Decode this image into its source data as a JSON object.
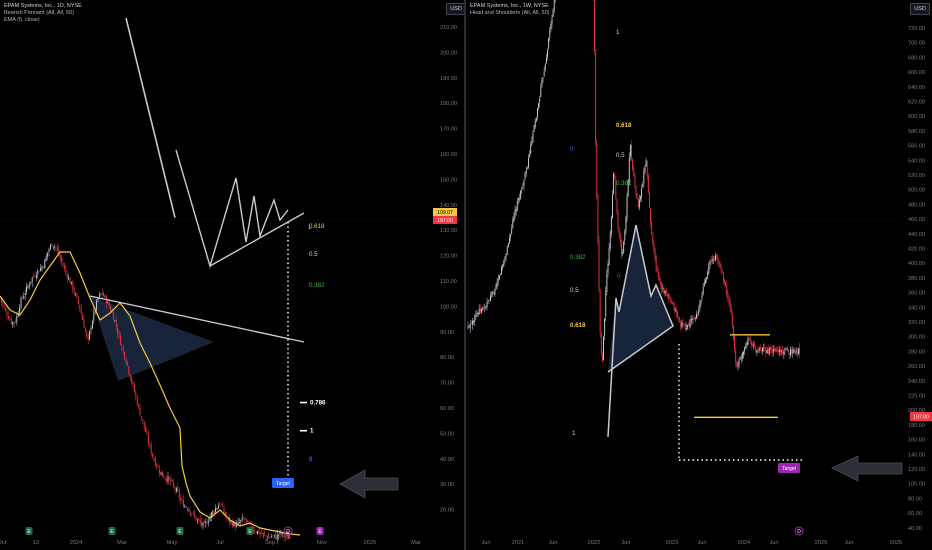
{
  "left_chart": {
    "header": {
      "title": "EPAM Systems, Inc., 1D, NYSE",
      "indicator1": "Bearish Pennant (All, All, 50)",
      "indicator2": "EMA (5, close)"
    },
    "currency_button": "USD",
    "price_tags": [
      "199.07",
      "197.00"
    ],
    "target_label": "Target",
    "pennant_label": "1",
    "fib_labels": [
      {
        "text": "0.618",
        "value": 133,
        "color": "#f5c842"
      },
      {
        "text": "0.5",
        "value": 122,
        "color": "#d1d4dc"
      },
      {
        "text": "0.382",
        "value": 110,
        "color": "#4caf50"
      },
      {
        "text": "0.786",
        "value": 64,
        "color": "#ffffff"
      },
      {
        "text": "1",
        "value": 53,
        "color": "#ffffff"
      },
      {
        "text": "0",
        "value": 42,
        "color": "#2962ff"
      }
    ],
    "event_icons": [
      "E",
      "E",
      "E",
      "E",
      "D",
      "E"
    ],
    "colors": {
      "up": "#d1d4dc",
      "down": "#f23645",
      "ema": "#f5c842",
      "pattern": "#c7cad1",
      "fill": "#1c2a44",
      "target": "#2962ff"
    }
  },
  "right_chart": {
    "header": {
      "title": "EPAM Systems, Inc., 1W, NYSE",
      "indicator1": "Head and Shoulders (All, All, 50)"
    },
    "currency_button": "USD",
    "price_tag": "197.00",
    "target_label": "Target",
    "fib_labels": [
      {
        "text": "1",
        "value": 715,
        "color": "#d1d4dc"
      },
      {
        "text": "0.618",
        "value": 542,
        "color": "#f5c842"
      },
      {
        "text": "0.5",
        "value": 512,
        "color": "#d1d4dc"
      },
      {
        "text": "0.382",
        "value": 482,
        "color": "#4caf50"
      },
      {
        "text": "0",
        "value": 500,
        "color": "#2962ff"
      },
      {
        "text": "0.382",
        "value": 409,
        "color": "#4caf50"
      },
      {
        "text": "0",
        "value": 377,
        "color": "#2962ff"
      },
      {
        "text": "0.5",
        "value": 352,
        "color": "#d1d4dc"
      },
      {
        "text": "0.618",
        "value": 325,
        "color": "#f5c842"
      },
      {
        "text": "1",
        "value": 166,
        "color": "#d1d4dc"
      }
    ],
    "event_icon": "D",
    "colors": {
      "up": "#d1d4dc",
      "down": "#f23645",
      "pattern": "#c7cad1",
      "fill": "#1c2a44",
      "neckline": "#f5c842",
      "target": "#9c27b0"
    }
  },
  "chart_data": [
    {
      "type": "candlestick",
      "title": "EPAM Systems, Inc., 1D, NYSE",
      "x_tick_labels": [
        "Oct",
        "13",
        "2024",
        "Mar",
        "May",
        "Jul",
        "Sep",
        "Nov",
        "2025",
        "Mar"
      ],
      "y_tick_labels": [
        "210.00",
        "200.00",
        "190.00",
        "180.00",
        "170.00",
        "160.00",
        "150.00",
        "140.00",
        "130.00",
        "120.00",
        "110.00",
        "100.00",
        "90.00",
        "80.00",
        "70.00",
        "60.00",
        "50.00",
        "40.00",
        "30.00",
        "20.00"
      ],
      "ylim": [
        15,
        215
      ],
      "price_path": [
        [
          0,
          250
        ],
        [
          4,
          240
        ],
        [
          8,
          232
        ],
        [
          12,
          225
        ],
        [
          16,
          228
        ],
        [
          20,
          245
        ],
        [
          24,
          254
        ],
        [
          28,
          262
        ],
        [
          32,
          270
        ],
        [
          36,
          275
        ],
        [
          40,
          279
        ],
        [
          44,
          284
        ],
        [
          48,
          297
        ],
        [
          52,
          305
        ],
        [
          56,
          300
        ],
        [
          60,
          290
        ],
        [
          66,
          275
        ],
        [
          72,
          262
        ],
        [
          80,
          240
        ],
        [
          88,
          205
        ],
        [
          90,
          218
        ],
        [
          94,
          235
        ],
        [
          98,
          250
        ],
        [
          102,
          255
        ],
        [
          106,
          248
        ],
        [
          110,
          240
        ],
        [
          114,
          230
        ],
        [
          118,
          215
        ],
        [
          122,
          200
        ],
        [
          126,
          188
        ],
        [
          130,
          172
        ],
        [
          134,
          158
        ],
        [
          138,
          142
        ],
        [
          142,
          128
        ],
        [
          146,
          115
        ],
        [
          150,
          100
        ],
        [
          154,
          88
        ],
        [
          158,
          80
        ],
        [
          162,
          73
        ],
        [
          166,
          70
        ],
        [
          170,
          68
        ],
        [
          174,
          60
        ],
        [
          178,
          55
        ],
        [
          181,
          46
        ],
        [
          184,
          43
        ],
        [
          188,
          40
        ],
        [
          192,
          35
        ],
        [
          196,
          29
        ],
        [
          200,
          25
        ],
        [
          204,
          22
        ],
        [
          208,
          28
        ],
        [
          212,
          35
        ],
        [
          216,
          40
        ],
        [
          220,
          45
        ],
        [
          224,
          35
        ],
        [
          228,
          28
        ],
        [
          232,
          25
        ],
        [
          236,
          22
        ],
        [
          240,
          26
        ],
        [
          244,
          29
        ],
        [
          248,
          24
        ],
        [
          252,
          20
        ],
        [
          256,
          17
        ],
        [
          260,
          15
        ],
        [
          264,
          13
        ],
        [
          268,
          10
        ],
        [
          272,
          12
        ],
        [
          276,
          11
        ],
        [
          280,
          15
        ],
        [
          284,
          12
        ],
        [
          288,
          10
        ],
        [
          292,
          13
        ],
        [
          296,
          14
        ],
        [
          300,
          14
        ],
        [
          304,
          13
        ]
      ],
      "ema_path": [
        [
          0,
          252
        ],
        [
          10,
          238
        ],
        [
          20,
          233
        ],
        [
          30,
          248
        ],
        [
          40,
          268
        ],
        [
          50,
          282
        ],
        [
          60,
          296
        ],
        [
          70,
          296
        ],
        [
          80,
          275
        ],
        [
          90,
          250
        ],
        [
          100,
          228
        ],
        [
          110,
          235
        ],
        [
          120,
          245
        ],
        [
          130,
          232
        ],
        [
          140,
          205
        ],
        [
          150,
          185
        ],
        [
          160,
          163
        ],
        [
          170,
          140
        ],
        [
          180,
          120
        ],
        [
          182,
          82
        ],
        [
          186,
          65
        ],
        [
          190,
          52
        ],
        [
          200,
          36
        ],
        [
          210,
          30
        ],
        [
          220,
          38
        ],
        [
          230,
          28
        ],
        [
          240,
          22
        ],
        [
          250,
          25
        ],
        [
          260,
          20
        ],
        [
          270,
          18
        ],
        [
          280,
          16
        ],
        [
          290,
          14
        ],
        [
          300,
          13
        ]
      ],
      "pennant": {
        "apex": [
          214,
          206
        ],
        "upper": [
          [
            90,
            252
          ],
          [
            214,
            206
          ]
        ],
        "lower": [
          [
            118,
            167
          ],
          [
            214,
            206
          ]
        ],
        "zigzag": [
          [
            175,
            246
          ],
          [
            183,
            168
          ],
          [
            187,
            234
          ],
          [
            190,
            173
          ],
          [
            198,
            225
          ],
          [
            201,
            175
          ],
          [
            206,
            221
          ],
          [
            209,
            192
          ],
          [
            212,
            210
          ]
        ]
      },
      "target_value": 42,
      "last_price": 197.0
    },
    {
      "type": "candlestick",
      "title": "EPAM Systems, Inc., 1W, NYSE",
      "x_tick_labels": [
        "Jun",
        "2021",
        "Jun",
        "2022",
        "Jun",
        "2023",
        "Jun",
        "2024",
        "Jun",
        "2025",
        "Jun",
        "2026"
      ],
      "y_tick_labels": [
        "720.00",
        "700.00",
        "680.00",
        "660.00",
        "640.00",
        "620.00",
        "600.00",
        "580.00",
        "560.00",
        "540.00",
        "520.00",
        "500.00",
        "480.00",
        "460.00",
        "440.00",
        "420.00",
        "400.00",
        "380.00",
        "360.00",
        "340.00",
        "320.00",
        "300.00",
        "280.00",
        "260.00",
        "240.00",
        "220.00",
        "200.00",
        "180.00",
        "160.00",
        "140.00",
        "120.00",
        "100.00",
        "80.00",
        "60.00",
        "40.00"
      ],
      "ylim": [
        35,
        730
      ],
      "price_path": [
        [
          0,
          217
        ],
        [
          10,
          234
        ],
        [
          20,
          242
        ],
        [
          30,
          260
        ],
        [
          40,
          295
        ],
        [
          50,
          340
        ],
        [
          60,
          375
        ],
        [
          70,
          430
        ],
        [
          80,
          490
        ],
        [
          90,
          560
        ],
        [
          100,
          620
        ],
        [
          110,
          660
        ],
        [
          116,
          720
        ],
        [
          120,
          690
        ],
        [
          124,
          620
        ],
        [
          128,
          540
        ],
        [
          130,
          380
        ],
        [
          134,
          220
        ],
        [
          136,
          180
        ],
        [
          140,
          260
        ],
        [
          144,
          310
        ],
        [
          148,
          380
        ],
        [
          152,
          320
        ],
        [
          156,
          290
        ],
        [
          160,
          330
        ],
        [
          164,
          405
        ],
        [
          168,
          370
        ],
        [
          172,
          340
        ],
        [
          176,
          360
        ],
        [
          180,
          390
        ],
        [
          184,
          330
        ],
        [
          190,
          280
        ],
        [
          196,
          260
        ],
        [
          202,
          250
        ],
        [
          208,
          240
        ],
        [
          214,
          225
        ],
        [
          220,
          220
        ],
        [
          226,
          228
        ],
        [
          232,
          233
        ],
        [
          238,
          265
        ],
        [
          244,
          285
        ],
        [
          250,
          292
        ],
        [
          256,
          276
        ],
        [
          262,
          250
        ],
        [
          266,
          228
        ],
        [
          270,
          182
        ],
        [
          274,
          188
        ],
        [
          278,
          200
        ],
        [
          282,
          210
        ],
        [
          286,
          205
        ],
        [
          290,
          197
        ]
      ],
      "head_and_shoulders": {
        "outline": [
          [
            142,
            212
          ],
          [
            150,
            353
          ],
          [
            153,
            329
          ],
          [
            170,
            405
          ],
          [
            185,
            360
          ],
          [
            190,
            367
          ],
          [
            207,
            323
          ],
          [
            142,
            212
          ]
        ]
      },
      "neckline_values": [
        300,
        188
      ],
      "target_value": 141,
      "last_price": 197.0
    }
  ]
}
